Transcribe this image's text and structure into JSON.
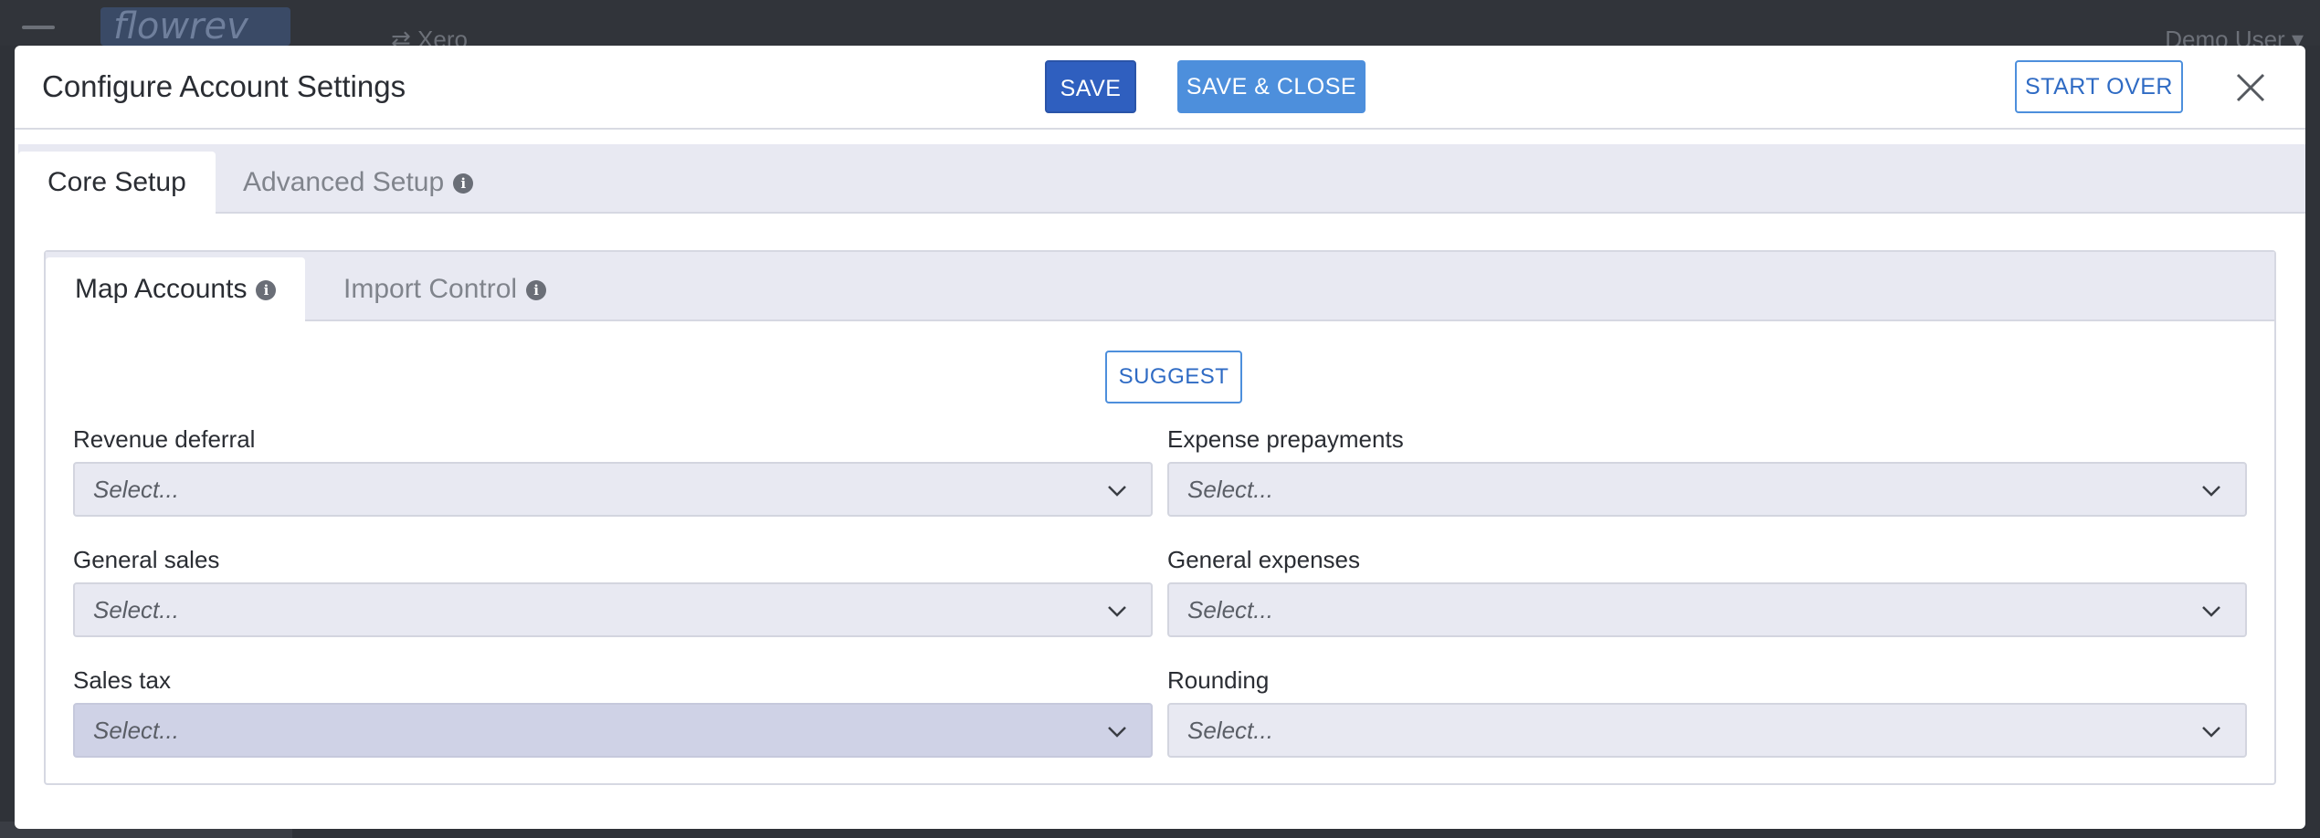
{
  "background": {
    "logo_text": "flowrev",
    "integration_label": "Xero",
    "user_label": "Demo User"
  },
  "modal": {
    "title": "Configure Account Settings",
    "buttons": {
      "save": "SAVE",
      "save_close": "SAVE & CLOSE",
      "start_over": "START OVER"
    }
  },
  "outer_tabs": [
    {
      "label": "Core Setup",
      "active": true
    },
    {
      "label": "Advanced Setup",
      "active": false
    }
  ],
  "inner_tabs": [
    {
      "label": "Map Accounts",
      "active": true
    },
    {
      "label": "Import Control",
      "active": false
    }
  ],
  "suggest_label": "SUGGEST",
  "fields": [
    {
      "label": "Revenue deferral",
      "value": "Select..."
    },
    {
      "label": "Expense prepayments",
      "value": "Select..."
    },
    {
      "label": "General sales",
      "value": "Select..."
    },
    {
      "label": "General expenses",
      "value": "Select..."
    },
    {
      "label": "Sales tax",
      "value": "Select..."
    },
    {
      "label": "Rounding",
      "value": "Select..."
    }
  ],
  "colors": {
    "primary": "#2f5fbf",
    "accent": "#4d8fdc",
    "tab_bar": "#e8e9f2",
    "select_highlight": "#cfd2e6"
  }
}
